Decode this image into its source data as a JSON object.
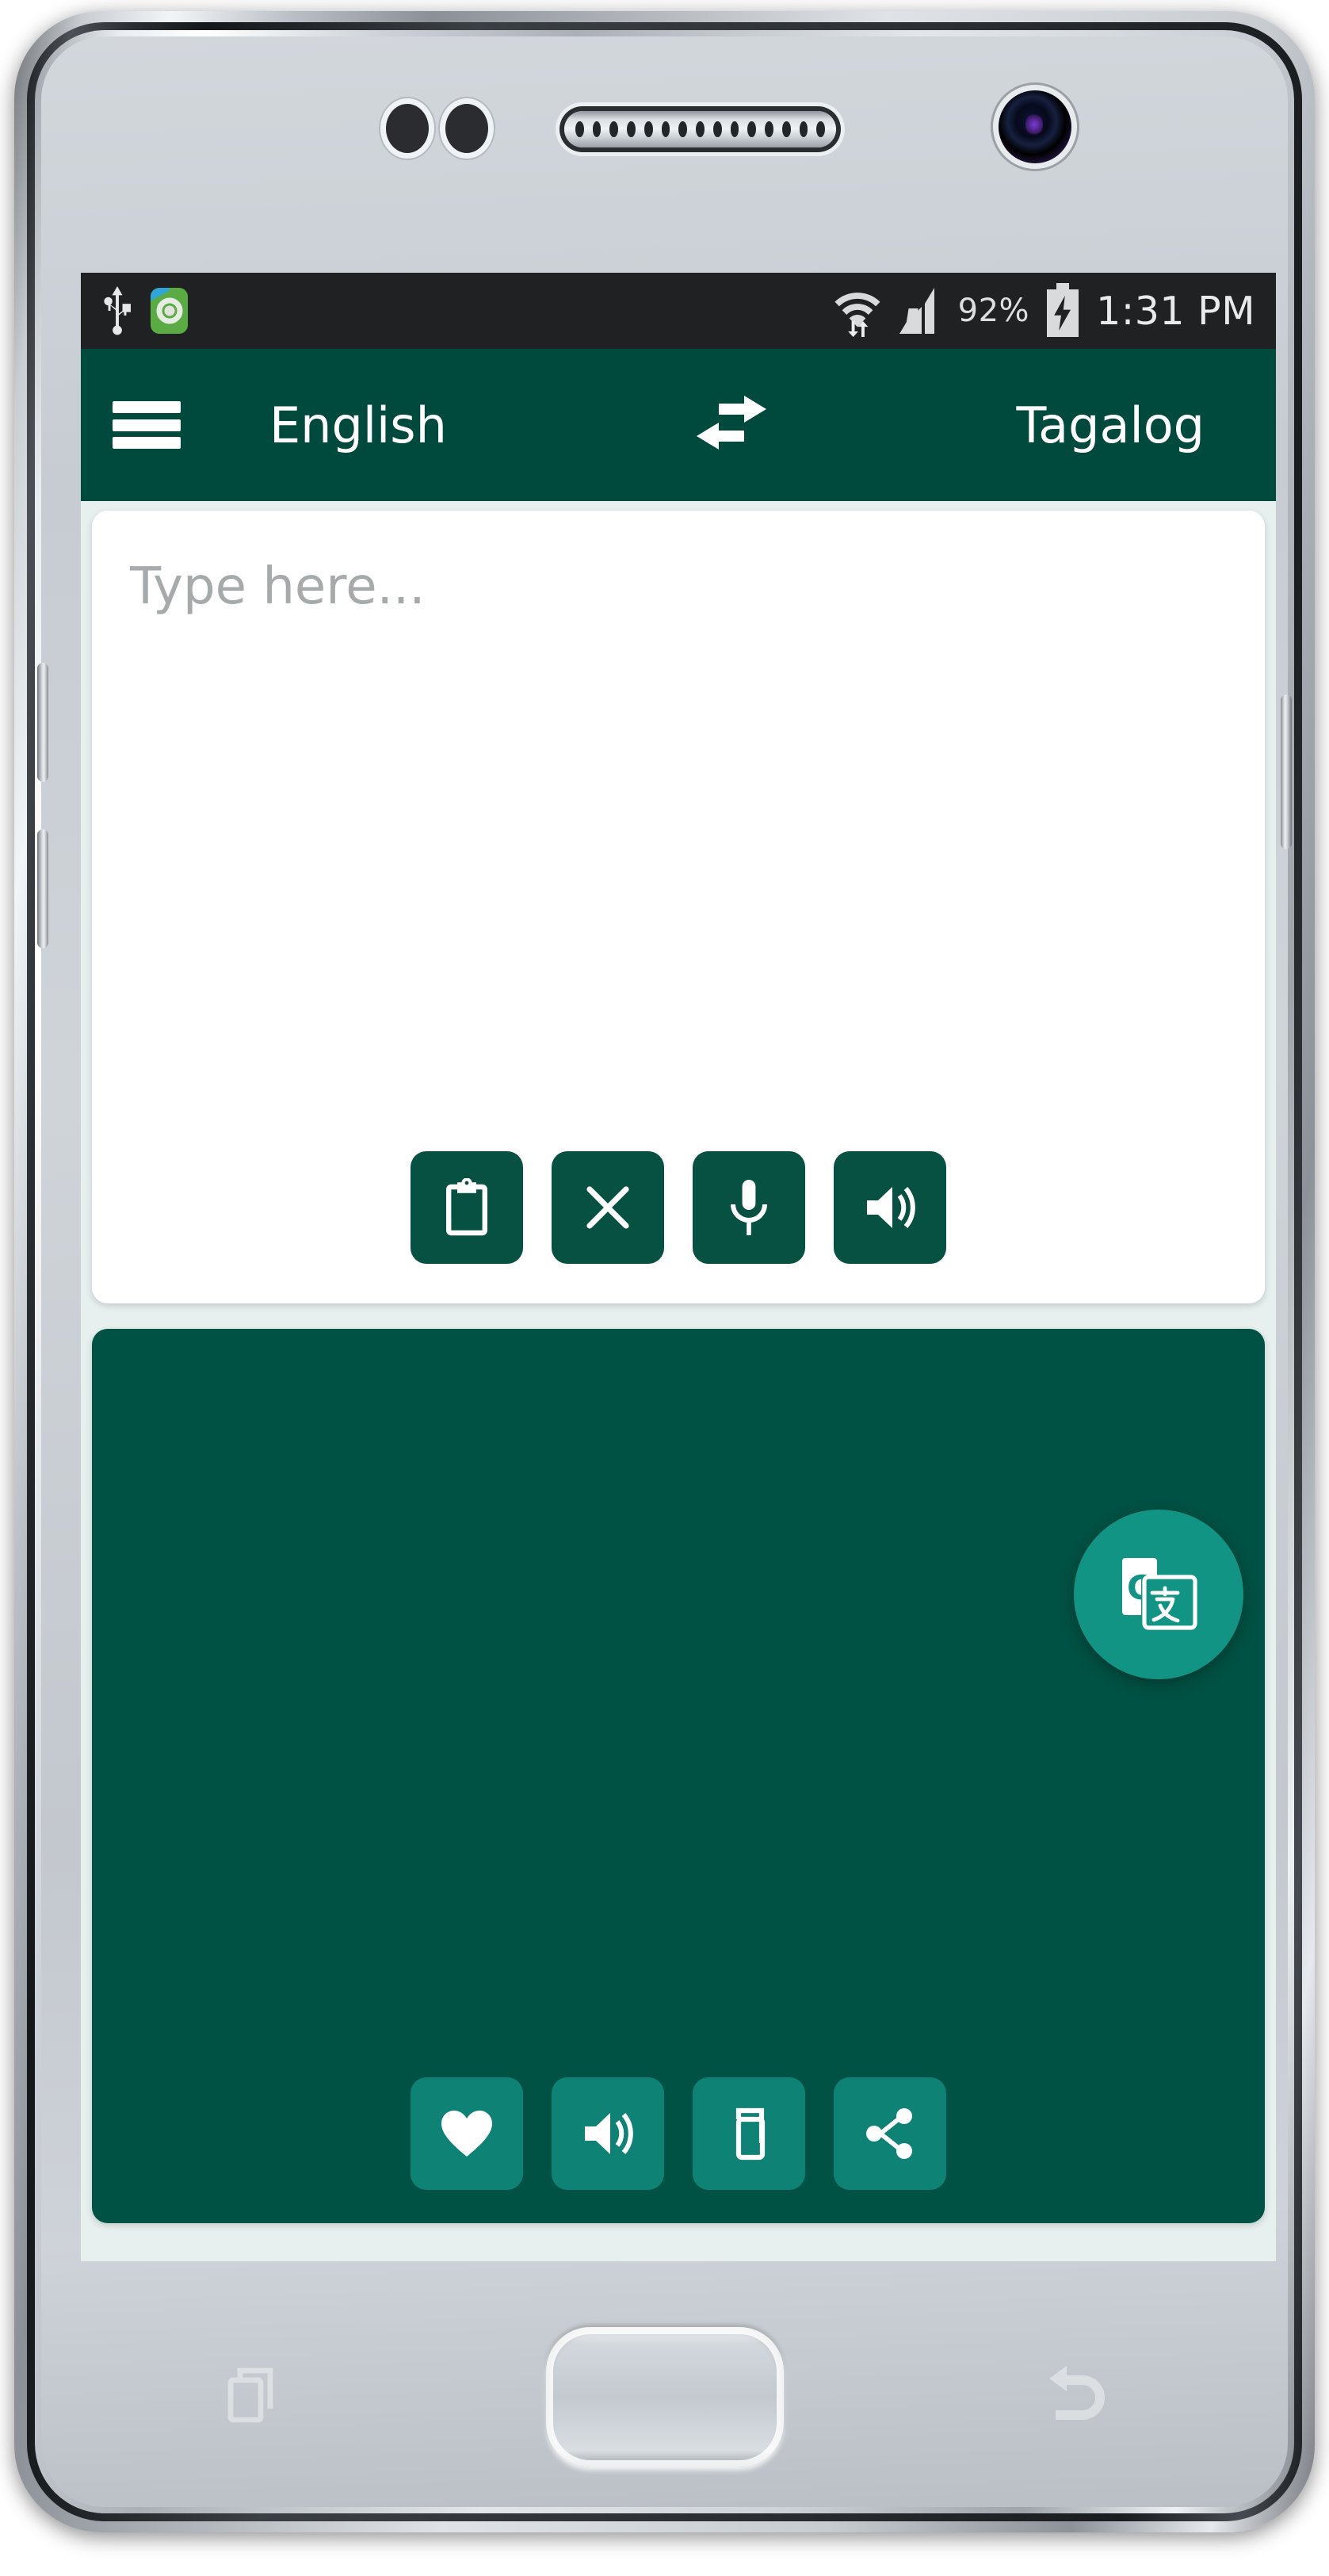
{
  "device": {
    "type": "android-phone",
    "hardware": {
      "earpiece": "earpiece-speaker",
      "front_camera": "front-camera",
      "sensors": "proximity-sensors",
      "home_button": "home-button",
      "recents_key": "recents-key",
      "back_key": "back-key",
      "volume_up": "volume-up-button",
      "volume_down": "volume-down-button",
      "power": "power-button"
    }
  },
  "statusbar": {
    "background": "#1f2122",
    "left_icons": [
      "usb-icon",
      "app-notification-icon"
    ],
    "wifi": "wifi-icon-with-data-arrows",
    "signal": "cellular-signal-icon",
    "battery_percent": "92%",
    "battery_state": "charging",
    "time": "1:31 PM"
  },
  "appbar": {
    "background": "#00493d",
    "menu_icon": "hamburger-menu-icon",
    "source_language": "English",
    "swap_icon": "swap-languages-icon",
    "target_language": "Tagalog"
  },
  "input_panel": {
    "background": "#ffffff",
    "placeholder": "Type here...",
    "value": "",
    "buttons": [
      {
        "name": "paste-button",
        "icon": "clipboard-icon",
        "label": "Paste"
      },
      {
        "name": "clear-button",
        "icon": "close-x-icon",
        "label": "Clear"
      },
      {
        "name": "microphone-button",
        "icon": "microphone-icon",
        "label": "Speak"
      },
      {
        "name": "speak-input-button",
        "icon": "speaker-icon",
        "label": "Listen"
      }
    ],
    "button_color": "#065141"
  },
  "output_panel": {
    "background": "#005244",
    "text": "",
    "buttons": [
      {
        "name": "favorite-button",
        "icon": "heart-icon",
        "label": "Favorite"
      },
      {
        "name": "speak-output-button",
        "icon": "speaker-icon",
        "label": "Listen"
      },
      {
        "name": "copy-button",
        "icon": "copy-icon",
        "label": "Copy"
      },
      {
        "name": "share-button",
        "icon": "share-icon",
        "label": "Share"
      }
    ],
    "button_color": "#0d8275"
  },
  "fab": {
    "name": "google-translate-fab",
    "icon": "google-translate-icon",
    "color": "#129484"
  },
  "colors": {
    "appbar": "#00493d",
    "output": "#005244",
    "accent_teal": "#129484",
    "button_dark": "#065141",
    "button_teal": "#0d8275",
    "screen_bg": "#e7f0ef"
  }
}
